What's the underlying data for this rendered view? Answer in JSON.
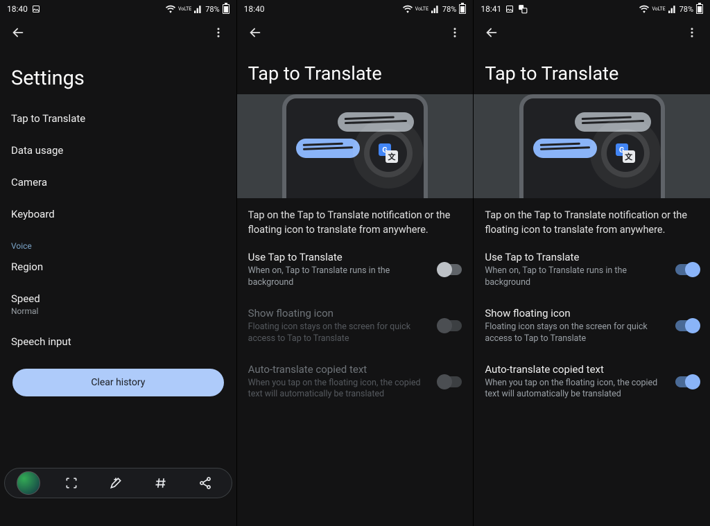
{
  "panel1": {
    "status": {
      "time": "18:40",
      "battery": "78%",
      "net": "LTE1",
      "vo": "VoLTE"
    },
    "title": "Settings",
    "items": [
      {
        "label": "Tap to Translate"
      },
      {
        "label": "Data usage"
      },
      {
        "label": "Camera"
      },
      {
        "label": "Keyboard"
      }
    ],
    "voice_section": "Voice",
    "voice_items": [
      {
        "label": "Region",
        "sub": ""
      },
      {
        "label": "Speed",
        "sub": "Normal"
      },
      {
        "label": "Speech input",
        "sub": ""
      }
    ],
    "clear_history": "Clear history"
  },
  "panel2": {
    "status": {
      "time": "18:40",
      "battery": "78%",
      "net": "LTE1",
      "vo": "VoLTE"
    },
    "title": "Tap to Translate",
    "description": "Tap on the Tap to Translate notification or the floating icon to translate from anywhere.",
    "settings": [
      {
        "title": "Use Tap to Translate",
        "sub": "When on, Tap to Translate runs in the background",
        "on": false,
        "enabled": true
      },
      {
        "title": "Show floating icon",
        "sub": "Floating icon stays on the screen for quick access to Tap to Translate",
        "on": false,
        "enabled": false
      },
      {
        "title": "Auto-translate copied text",
        "sub": "When you tap on the floating icon, the copied text will automatically be translated",
        "on": false,
        "enabled": false
      }
    ]
  },
  "panel3": {
    "status": {
      "time": "18:41",
      "battery": "78%",
      "net": "LTE1",
      "vo": "VoLTE"
    },
    "title": "Tap to Translate",
    "description": "Tap on the Tap to Translate notification or the floating icon to translate from anywhere.",
    "settings": [
      {
        "title": "Use Tap to Translate",
        "sub": "When on, Tap to Translate runs in the background",
        "on": true,
        "enabled": true
      },
      {
        "title": "Show floating icon",
        "sub": "Floating icon stays on the screen for quick access to Tap to Translate",
        "on": true,
        "enabled": true
      },
      {
        "title": "Auto-translate copied text",
        "sub": "When you tap on the floating icon, the copied text will automatically be translated",
        "on": true,
        "enabled": true
      }
    ]
  }
}
